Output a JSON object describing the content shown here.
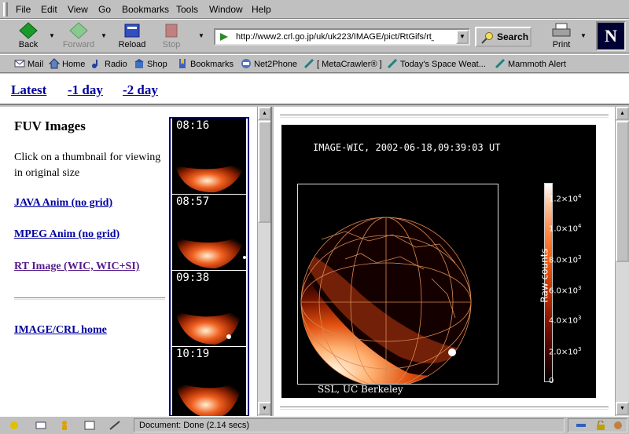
{
  "menu": [
    "File",
    "Edit",
    "View",
    "Go",
    "Bookmarks",
    "Tools",
    "Window",
    "Help"
  ],
  "toolbar": {
    "back": "Back",
    "forward": "Forward",
    "reload": "Reload",
    "stop": "Stop",
    "url": "http://www2.crl.go.jp/uk/uk223/IMAGE/pict/RtGifs/rt_fra",
    "search": "Search",
    "print": "Print",
    "logo": "N"
  },
  "personal_bar": [
    "Mail",
    "Home",
    "Radio",
    "Shop",
    "Bookmarks",
    "Net2Phone",
    "[ MetaCrawler® ]",
    "Today's Space Weat...",
    "Mammoth Alert"
  ],
  "top_links": [
    "Latest",
    "-1 day",
    "-2 day"
  ],
  "left": {
    "title": "FUV Images",
    "instructions": "Click on a thumbnail for viewing in original size",
    "java_anim": "JAVA Anim",
    "java_nogrid": "(no grid)",
    "mpeg_anim": "MPEG Anim",
    "mpeg_nogrid": "(no grid)",
    "rt_image": "RT Image (WIC, WIC+SI)",
    "home": "IMAGE/CRL home"
  },
  "thumbnails": [
    "08:16",
    "08:57",
    "09:38",
    "10:19"
  ],
  "main_image": {
    "title": "IMAGE-WIC, 2002-06-18,09:39:03 UT",
    "credit": "SSL, UC Berkeley",
    "colorbar_label": "Raw counts",
    "ticks": [
      {
        "mant": "1.2",
        "exp": "4",
        "frac": 0.92
      },
      {
        "mant": "1.0",
        "exp": "4",
        "frac": 0.77
      },
      {
        "mant": "8.0",
        "exp": "3",
        "frac": 0.615
      },
      {
        "mant": "6.0",
        "exp": "3",
        "frac": 0.46
      },
      {
        "mant": "4.0",
        "exp": "3",
        "frac": 0.31
      },
      {
        "mant": "2.0",
        "exp": "3",
        "frac": 0.155
      },
      {
        "mant": "0",
        "exp": "",
        "frac": 0.0
      }
    ]
  },
  "status": {
    "text": "Document: Done (2.14 secs)"
  }
}
